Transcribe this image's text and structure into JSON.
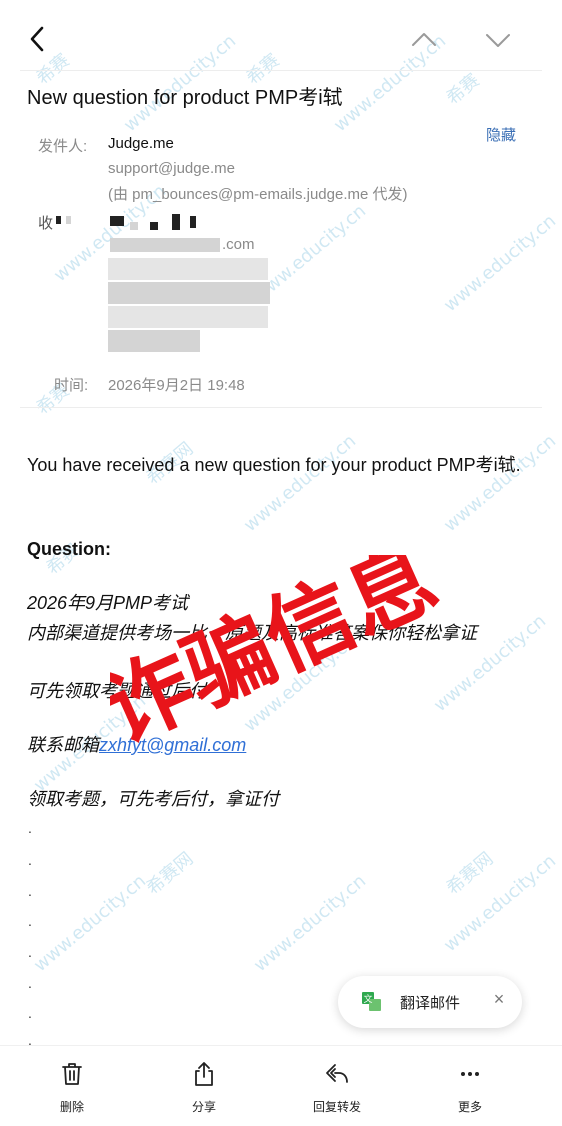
{
  "email": {
    "subject": "New question for product PMP考i轼",
    "from_label": "发件人:",
    "sender_name": "Judge.me",
    "sender_email": "support@judge.me",
    "sender_via": "(由 pm_bounces@pm-emails.judge.me 代发)",
    "hide_label": "隐藏",
    "to_label_partial": "收",
    "to_email_partial": ".com",
    "time_label": "时间:",
    "time_value": "2026年9月2日 19:48"
  },
  "content": {
    "intro": "You have received a new question for your product PMP考i轼.",
    "question_heading": "Question:",
    "line1": "2026年9月PMP考试",
    "line2": "内部渠道提供考场一比一原题及高标准答案保你轻松拿证",
    "line3": "可先领取考题通过后付",
    "contact_prefix": "联系邮箱",
    "contact_email": "zxhfyt@gmail.com",
    "line5": "领取考题，可先考后付，拿证付"
  },
  "stamp": {
    "text": "诈骗信息",
    "color": "#e8141a"
  },
  "translate": {
    "label": "翻译邮件",
    "close": "×",
    "icon": "translate-icon"
  },
  "bottom_bar": {
    "delete_label": "删除",
    "share_label": "分享",
    "reply_label": "回复转发",
    "more_label": "更多"
  },
  "watermark": {
    "brand": "希赛",
    "site": "www.educity.cn",
    "alt": "希赛网"
  }
}
